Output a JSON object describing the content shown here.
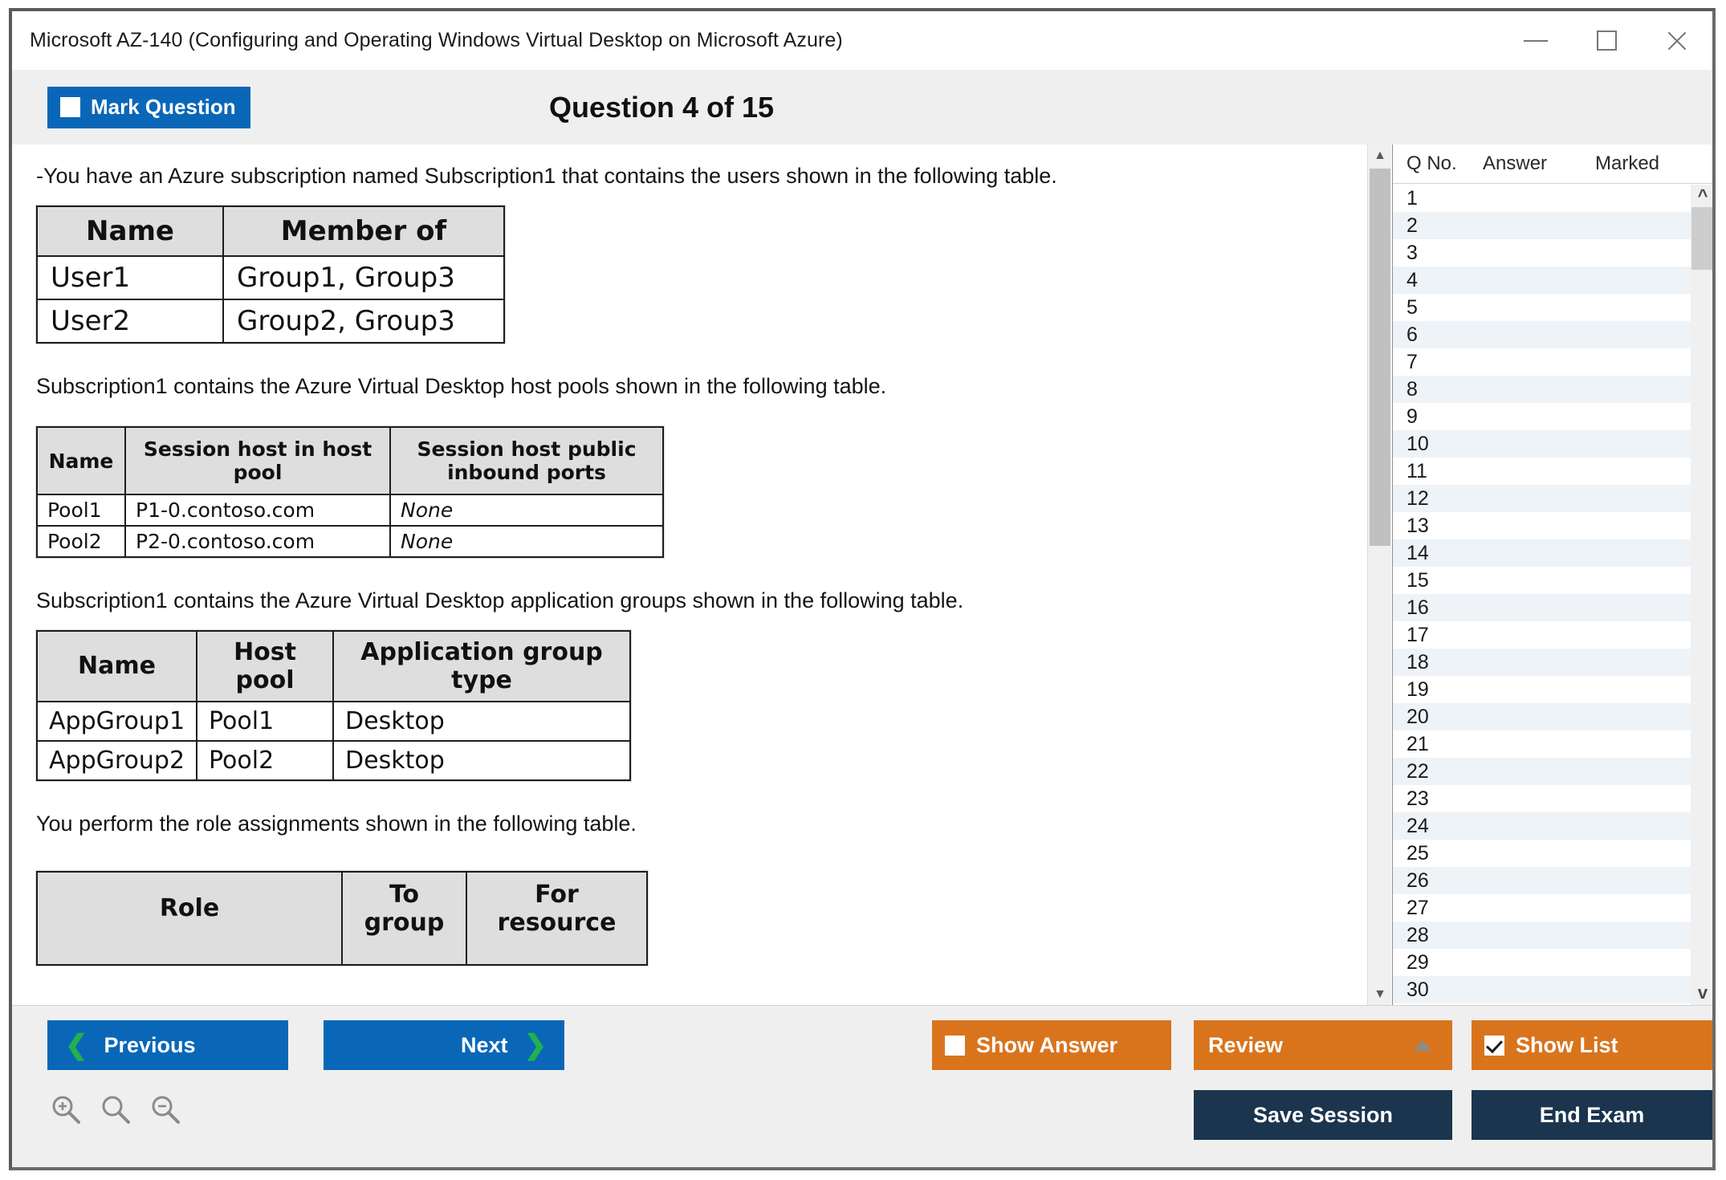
{
  "window": {
    "title": "Microsoft AZ-140 (Configuring and Operating Windows Virtual Desktop on Microsoft Azure)",
    "controls": {
      "minimize": "minimize-icon",
      "maximize": "maximize-icon",
      "close": "close-icon"
    }
  },
  "header": {
    "mark_question_label": "Mark Question",
    "mark_question_checked": false,
    "question_counter": "Question 4 of 15"
  },
  "content": {
    "paragraphs": {
      "p1": "-You have an Azure subscription named Subscription1 that contains the users shown in the following table.",
      "p2": "Subscription1 contains the Azure Virtual Desktop host pools shown in the following table.",
      "p3": "Subscription1 contains the Azure Virtual Desktop application groups shown in the following table.",
      "p4": "You perform the role assignments shown in the following table."
    },
    "table_users": {
      "headers": [
        "Name",
        "Member of"
      ],
      "rows": [
        [
          "User1",
          "Group1, Group3"
        ],
        [
          "User2",
          "Group2, Group3"
        ]
      ]
    },
    "table_hostpools": {
      "headers": [
        "Name",
        "Session host in host pool",
        "Session host public inbound ports"
      ],
      "rows": [
        [
          "Pool1",
          "P1-0.contoso.com",
          "None"
        ],
        [
          "Pool2",
          "P2-0.contoso.com",
          "None"
        ]
      ]
    },
    "table_appgroups": {
      "headers": [
        "Name",
        "Host pool",
        "Application group type"
      ],
      "rows": [
        [
          "AppGroup1",
          "Pool1",
          "Desktop"
        ],
        [
          "AppGroup2",
          "Pool2",
          "Desktop"
        ]
      ]
    },
    "table_roleassignments": {
      "headers": [
        "Role",
        "To group",
        "For resource"
      ]
    }
  },
  "question_list": {
    "columns": [
      "Q No.",
      "Answer",
      "Marked"
    ],
    "rows": [
      {
        "no": "1",
        "answer": "",
        "marked": ""
      },
      {
        "no": "2",
        "answer": "",
        "marked": ""
      },
      {
        "no": "3",
        "answer": "",
        "marked": ""
      },
      {
        "no": "4",
        "answer": "",
        "marked": ""
      },
      {
        "no": "5",
        "answer": "",
        "marked": ""
      },
      {
        "no": "6",
        "answer": "",
        "marked": ""
      },
      {
        "no": "7",
        "answer": "",
        "marked": ""
      },
      {
        "no": "8",
        "answer": "",
        "marked": ""
      },
      {
        "no": "9",
        "answer": "",
        "marked": ""
      },
      {
        "no": "10",
        "answer": "",
        "marked": ""
      },
      {
        "no": "11",
        "answer": "",
        "marked": ""
      },
      {
        "no": "12",
        "answer": "",
        "marked": ""
      },
      {
        "no": "13",
        "answer": "",
        "marked": ""
      },
      {
        "no": "14",
        "answer": "",
        "marked": ""
      },
      {
        "no": "15",
        "answer": "",
        "marked": ""
      },
      {
        "no": "16",
        "answer": "",
        "marked": ""
      },
      {
        "no": "17",
        "answer": "",
        "marked": ""
      },
      {
        "no": "18",
        "answer": "",
        "marked": ""
      },
      {
        "no": "19",
        "answer": "",
        "marked": ""
      },
      {
        "no": "20",
        "answer": "",
        "marked": ""
      },
      {
        "no": "21",
        "answer": "",
        "marked": ""
      },
      {
        "no": "22",
        "answer": "",
        "marked": ""
      },
      {
        "no": "23",
        "answer": "",
        "marked": ""
      },
      {
        "no": "24",
        "answer": "",
        "marked": ""
      },
      {
        "no": "25",
        "answer": "",
        "marked": ""
      },
      {
        "no": "26",
        "answer": "",
        "marked": ""
      },
      {
        "no": "27",
        "answer": "",
        "marked": ""
      },
      {
        "no": "28",
        "answer": "",
        "marked": ""
      },
      {
        "no": "29",
        "answer": "",
        "marked": ""
      },
      {
        "no": "30",
        "answer": "",
        "marked": ""
      }
    ]
  },
  "footer": {
    "previous_label": "Previous",
    "next_label": "Next",
    "show_answer_label": "Show Answer",
    "show_answer_checked": false,
    "review_label": "Review",
    "show_list_label": "Show List",
    "show_list_checked": true,
    "save_session_label": "Save Session",
    "end_exam_label": "End Exam",
    "zoom_icons": [
      "zoom-in-icon",
      "zoom-reset-icon",
      "zoom-out-icon"
    ]
  },
  "colors": {
    "primary_blue": "#0a67b8",
    "accent_orange": "#d9741d",
    "navy": "#1b354f",
    "green_chevron": "#22b14c",
    "header_strip": "#efefef",
    "row_alt": "#eef3f8"
  }
}
